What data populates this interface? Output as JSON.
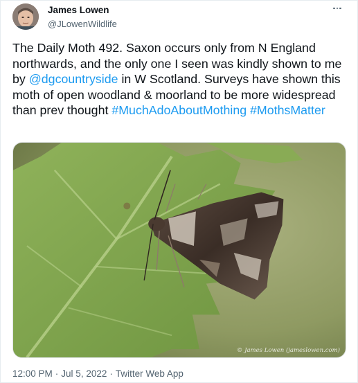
{
  "author": {
    "display_name": "James Lowen",
    "handle": "@JLowenWildlife"
  },
  "tweet": {
    "text_segments": [
      {
        "text": "The Daily Moth 492. Saxon occurs only from N England northwards, and the only one I seen was kindly shown to me by ",
        "type": "text"
      },
      {
        "text": "@dgcountryside",
        "type": "mention"
      },
      {
        "text": " in W Scotland. Surveys have shown this moth of open woodland & moorland to be more widespread than prev thought ",
        "type": "text"
      },
      {
        "text": "#MuchAdoAboutMothing",
        "type": "hashtag"
      },
      {
        "text": " ",
        "type": "text"
      },
      {
        "text": "#MothsMatter",
        "type": "hashtag"
      }
    ]
  },
  "media": {
    "watermark": "© James Lowen (jameslowen.com)"
  },
  "meta": {
    "time": "12:00 PM",
    "date": "Jul 5, 2022",
    "source": "Twitter Web App"
  },
  "colors": {
    "link": "#1d9bf0",
    "secondary_text": "#536471",
    "primary_text": "#0f1419"
  },
  "icons": {
    "more": "more-horizontal-icon"
  }
}
